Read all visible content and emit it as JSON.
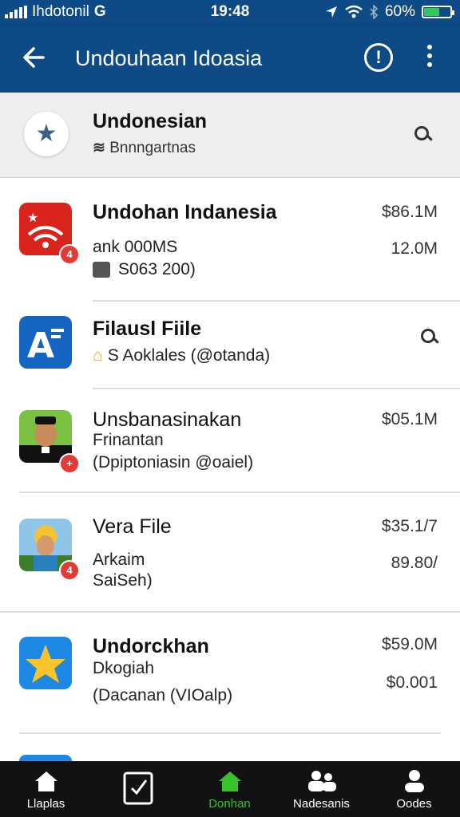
{
  "status_bar": {
    "carrier": "Ihdotonil",
    "network": "G",
    "time": "19:48",
    "battery": "60%",
    "battery_level": 0.6
  },
  "app_bar": {
    "title": "Undouhaan Idoasia",
    "back_icon": "arrow-left-icon",
    "info_icon": "info-icon",
    "more_icon": "more-vertical-icon"
  },
  "favorite": {
    "name": "Undonesian",
    "subtitle": "Bnnngartnas",
    "star_icon": "star-icon",
    "search_icon": "search-icon"
  },
  "items": [
    {
      "title": "Undohan Indanesia",
      "line2": "ank 000MS",
      "line3": "S063 200)",
      "price": "$86.1M",
      "price2": "12.0M",
      "badge": "4"
    },
    {
      "title": "Filausl Fiile",
      "line2": "S Aoklales  (@otanda)",
      "action_icon": "search-icon"
    },
    {
      "title": "Unsbanasinakan",
      "line2": "Frinantan",
      "line3": "(Dpiptoniasin  @oaiel)",
      "price": "$05.1M"
    },
    {
      "title": "Vera File",
      "line2": "Arkaim",
      "line3": "SaiSeh)",
      "price": "$35.1/7",
      "price2": "89.80/​",
      "badge": "4"
    },
    {
      "title": "Undorckhan",
      "line2": "Dkogiah",
      "line3": "(Dacanan  (VIOalp)",
      "price": "$59.0M",
      "price2": "$0.001"
    }
  ],
  "bottom_nav": [
    {
      "label": "Llaplas",
      "icon": "home-icon"
    },
    {
      "label": "",
      "icon": "checkbox-icon"
    },
    {
      "label": "Donhan",
      "icon": "home-icon",
      "active": true
    },
    {
      "label": "Nadesanis",
      "icon": "people-icon"
    },
    {
      "label": "Oodes",
      "icon": "person-icon"
    }
  ],
  "colors": {
    "primary": "#0e4a86",
    "accent": "#37c22b",
    "badge": "#e53935"
  }
}
